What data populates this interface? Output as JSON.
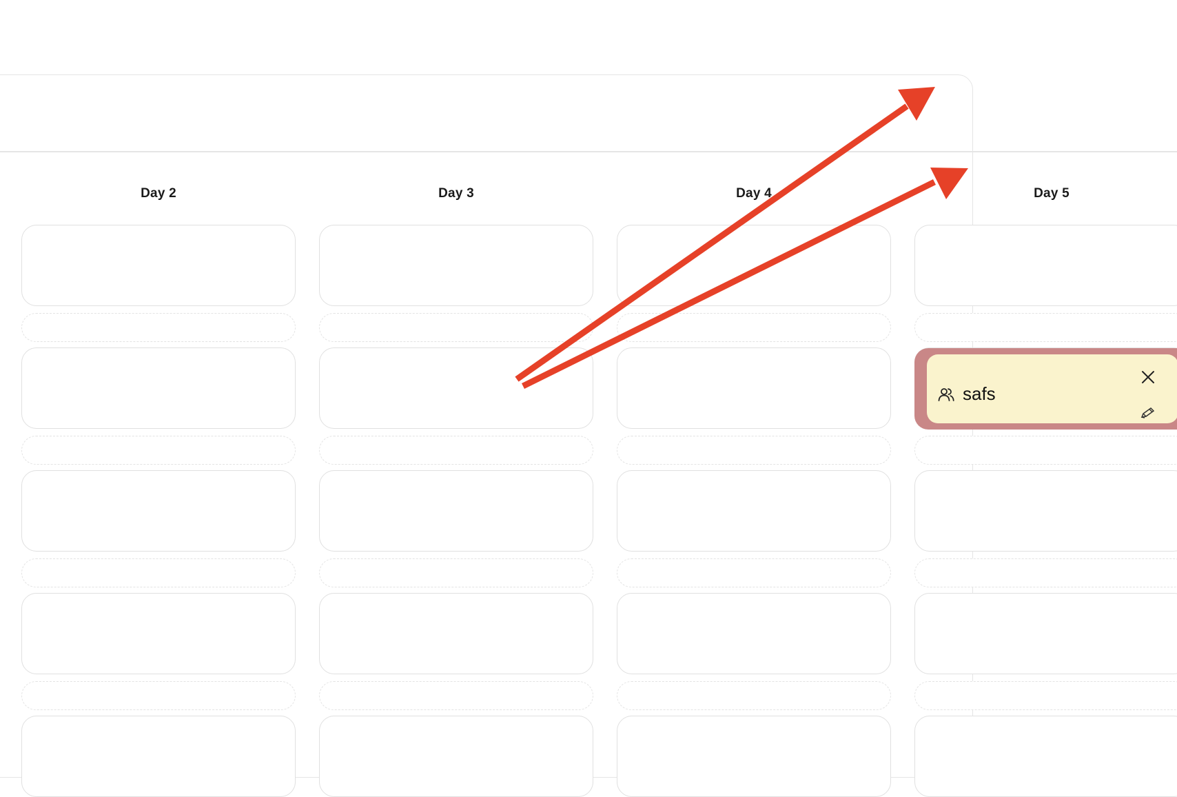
{
  "days": [
    {
      "label": "Day 2"
    },
    {
      "label": "Day 3"
    },
    {
      "label": "Day 4"
    },
    {
      "label": "Day 5"
    }
  ],
  "event": {
    "title": "safs",
    "day": "Day 5",
    "icon": "people-icon",
    "actions": [
      "close-icon",
      "pencil-icon"
    ]
  },
  "colors": {
    "event_background": "#faf3cd",
    "event_border": "#c98787",
    "annotation_arrow": "#e64128",
    "slot_border": "#e0e0e0"
  }
}
